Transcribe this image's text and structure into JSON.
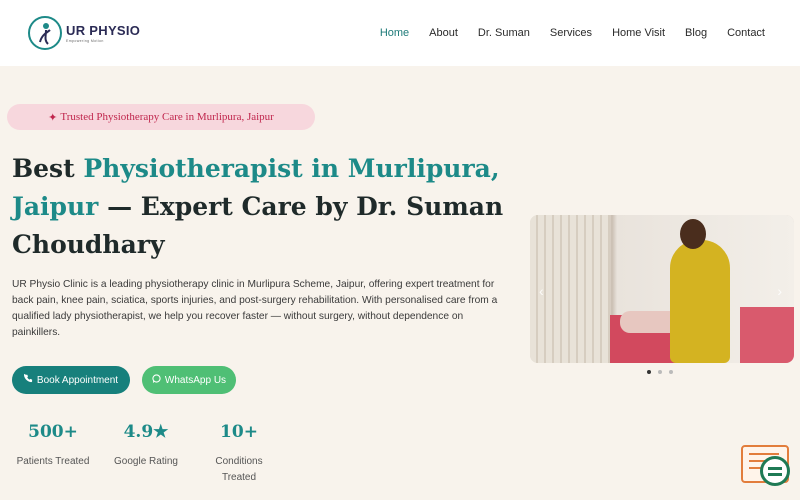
{
  "header": {
    "logo_name": "UR PHYSIO",
    "logo_tagline": "Empowering Motion",
    "nav": [
      {
        "label": "Home",
        "active": true
      },
      {
        "label": "About"
      },
      {
        "label": "Dr. Suman"
      },
      {
        "label": "Services"
      },
      {
        "label": "Home Visit"
      },
      {
        "label": "Blog"
      },
      {
        "label": "Contact"
      }
    ]
  },
  "hero": {
    "badge": "Trusted Physiotherapy Care in Murlipura, Jaipur",
    "badge_icon": "✦",
    "title_part1": "Best ",
    "title_highlight": "Physiotherapist in Murlipura, Jaipur",
    "title_part2": " — Expert Care by Dr. Suman Choudhary",
    "description": "UR Physio Clinic is a leading physiotherapy clinic in Murlipura Scheme, Jaipur, offering expert treatment for back pain, knee pain, sciatica, sports injuries, and post-surgery rehabilitation. With personalised care from a qualified lady physiotherapist, we help you recover faster — without surgery, without dependence on painkillers.",
    "buttons": {
      "book": "Book Appointment",
      "whatsapp": "WhatsApp Us"
    },
    "stats": [
      {
        "value": "500+",
        "label": "Patients Treated"
      },
      {
        "value": "4.9★",
        "label": "Google Rating"
      },
      {
        "value": "10+",
        "label": "Conditions Treated"
      }
    ]
  },
  "slider": {
    "prev_icon": "‹",
    "next_icon": "›",
    "dots": 3,
    "active_dot": 0
  },
  "colors": {
    "accent": "#1d8a88",
    "book_button": "#17807c",
    "whatsapp_button": "#4fbf75",
    "badge_bg": "#f7d7dd",
    "badge_text": "#c0264d",
    "background": "#f8f3ec"
  }
}
